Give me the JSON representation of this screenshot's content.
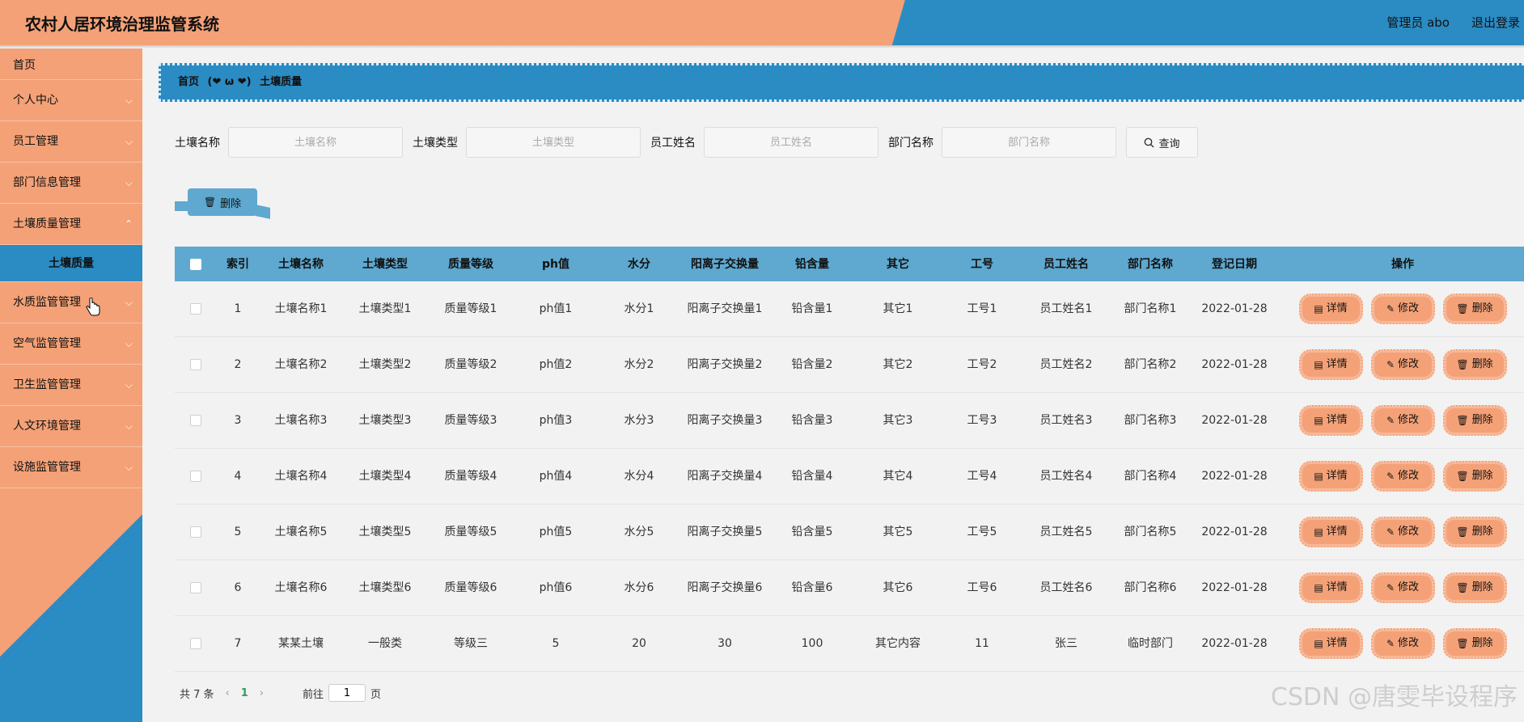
{
  "header": {
    "title": "农村人居环境治理监管系统",
    "user": "管理员 abo",
    "logout": "退出登录"
  },
  "sidebar": {
    "items": [
      {
        "label": "首页",
        "chevron": false
      },
      {
        "label": "个人中心",
        "chevron": true
      },
      {
        "label": "员工管理",
        "chevron": true
      },
      {
        "label": "部门信息管理",
        "chevron": true
      },
      {
        "label": "土壤质量管理",
        "chevron": true
      }
    ],
    "active_sub": "土壤质量",
    "items_after": [
      {
        "label": "水质监管管理"
      },
      {
        "label": "空气监管管理"
      },
      {
        "label": "卫生监管管理"
      },
      {
        "label": "人文环境管理"
      },
      {
        "label": "设施监管管理"
      }
    ]
  },
  "breadcrumb": {
    "home": "首页",
    "sep": "(❤ ω ❤)",
    "current": "土壤质量"
  },
  "search": {
    "fields": [
      {
        "label": "土壤名称",
        "placeholder": "土壤名称"
      },
      {
        "label": "土壤类型",
        "placeholder": "土壤类型"
      },
      {
        "label": "员工姓名",
        "placeholder": "员工姓名"
      },
      {
        "label": "部门名称",
        "placeholder": "部门名称"
      }
    ],
    "button": "查询"
  },
  "toolbar": {
    "delete": "删除"
  },
  "table": {
    "headers": [
      "索引",
      "土壤名称",
      "土壤类型",
      "质量等级",
      "ph值",
      "水分",
      "阳离子交换量",
      "铅含量",
      "其它",
      "工号",
      "员工姓名",
      "部门名称",
      "登记日期",
      "操作"
    ],
    "rows": [
      [
        "1",
        "土壤名称1",
        "土壤类型1",
        "质量等级1",
        "ph值1",
        "水分1",
        "阳离子交换量1",
        "铅含量1",
        "其它1",
        "工号1",
        "员工姓名1",
        "部门名称1",
        "2022-01-28"
      ],
      [
        "2",
        "土壤名称2",
        "土壤类型2",
        "质量等级2",
        "ph值2",
        "水分2",
        "阳离子交换量2",
        "铅含量2",
        "其它2",
        "工号2",
        "员工姓名2",
        "部门名称2",
        "2022-01-28"
      ],
      [
        "3",
        "土壤名称3",
        "土壤类型3",
        "质量等级3",
        "ph值3",
        "水分3",
        "阳离子交换量3",
        "铅含量3",
        "其它3",
        "工号3",
        "员工姓名3",
        "部门名称3",
        "2022-01-28"
      ],
      [
        "4",
        "土壤名称4",
        "土壤类型4",
        "质量等级4",
        "ph值4",
        "水分4",
        "阳离子交换量4",
        "铅含量4",
        "其它4",
        "工号4",
        "员工姓名4",
        "部门名称4",
        "2022-01-28"
      ],
      [
        "5",
        "土壤名称5",
        "土壤类型5",
        "质量等级5",
        "ph值5",
        "水分5",
        "阳离子交换量5",
        "铅含量5",
        "其它5",
        "工号5",
        "员工姓名5",
        "部门名称5",
        "2022-01-28"
      ],
      [
        "6",
        "土壤名称6",
        "土壤类型6",
        "质量等级6",
        "ph值6",
        "水分6",
        "阳离子交换量6",
        "铅含量6",
        "其它6",
        "工号6",
        "员工姓名6",
        "部门名称6",
        "2022-01-28"
      ],
      [
        "7",
        "某某土壤",
        "一般类",
        "等级三",
        "5",
        "20",
        "30",
        "100",
        "其它内容",
        "11",
        "张三",
        "临时部门",
        "2022-01-28"
      ]
    ],
    "ops": {
      "detail": "详情",
      "edit": "修改",
      "delete": "删除"
    }
  },
  "pager": {
    "total": "共 7 条",
    "prev": "‹",
    "page": "1",
    "next": "›",
    "goto": "前往",
    "goto_value": "1",
    "page_unit": "页"
  },
  "watermark": "CSDN @唐雯毕设程序",
  "colors": {
    "orange": "#f4a177",
    "blue": "#2b8bc3",
    "light_blue": "#5fa8cf"
  }
}
